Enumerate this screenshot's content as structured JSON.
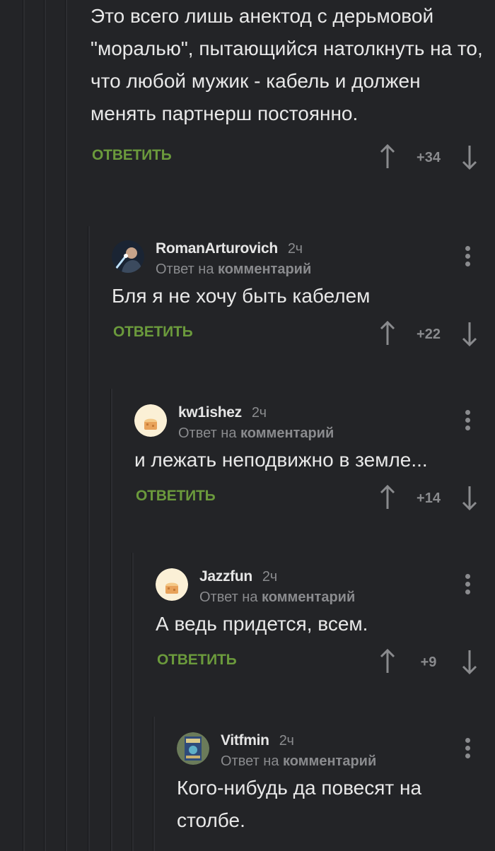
{
  "top": {
    "text": "Это всего лишь анектод с дерьмовой \"моралью\", пытающийся натолкнуть на то, что любой мужик - кабель и должен менять партнерш постоянно.",
    "reply_label": "ОТВЕТИТЬ",
    "score": "+34"
  },
  "comments": [
    {
      "author": "RomanArturovich",
      "time": "2ч",
      "reply_prefix": "Ответ на",
      "reply_target": "комментарий",
      "text": "Бля я не хочу быть кабелем",
      "reply_label": "ОТВЕТИТЬ",
      "score": "+22",
      "avatar": "photo-avatar"
    },
    {
      "author": "kw1ishez",
      "time": "2ч",
      "reply_prefix": "Ответ на",
      "reply_target": "комментарий",
      "text": "и лежать неподвижно в земле...",
      "reply_label": "ОТВЕТИТЬ",
      "score": "+14",
      "avatar": "default-cake-avatar"
    },
    {
      "author": "Jazzfun",
      "time": "2ч",
      "reply_prefix": "Ответ на",
      "reply_target": "комментарий",
      "text": "А ведь придется, всем.",
      "reply_label": "ОТВЕТИТЬ",
      "score": "+9",
      "avatar": "default-cake-avatar"
    },
    {
      "author": "Vitfmin",
      "time": "2ч",
      "reply_prefix": "Ответ на",
      "reply_target": "комментарий",
      "text": "Кого-нибудь да повесят на столбе.",
      "avatar": "book-cover-avatar"
    }
  ],
  "colors": {
    "background": "#232427",
    "text": "#e8e8e8",
    "muted": "#8a8b8e",
    "reply_green": "#6b9a3c",
    "thread_line": "#2c2d31"
  },
  "icons": [
    "arrow-up-icon",
    "arrow-down-icon",
    "more-vertical-icon"
  ]
}
